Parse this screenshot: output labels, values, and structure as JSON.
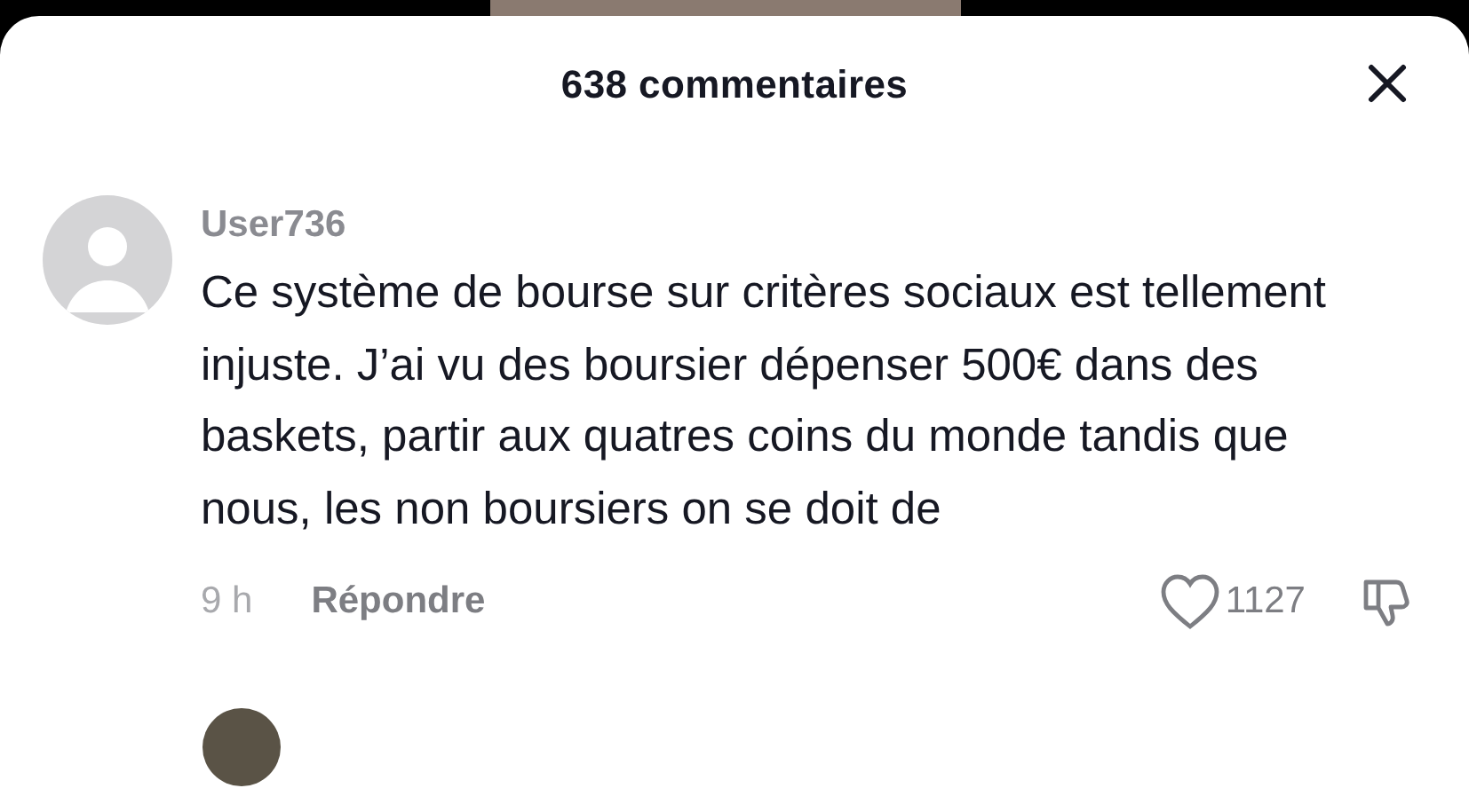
{
  "header": {
    "title": "638 commentaires"
  },
  "comments": [
    {
      "username": "User736",
      "text": "Ce système de bourse sur critères sociaux est tellement injuste. J’ai vu des boursier dépenser 500€ dans des baskets, partir aux quatres coins du monde tandis que nous, les non boursiers on se doit de",
      "time": "9 h",
      "reply": "Répondre",
      "likes": "1127",
      "liked": false
    }
  ]
}
